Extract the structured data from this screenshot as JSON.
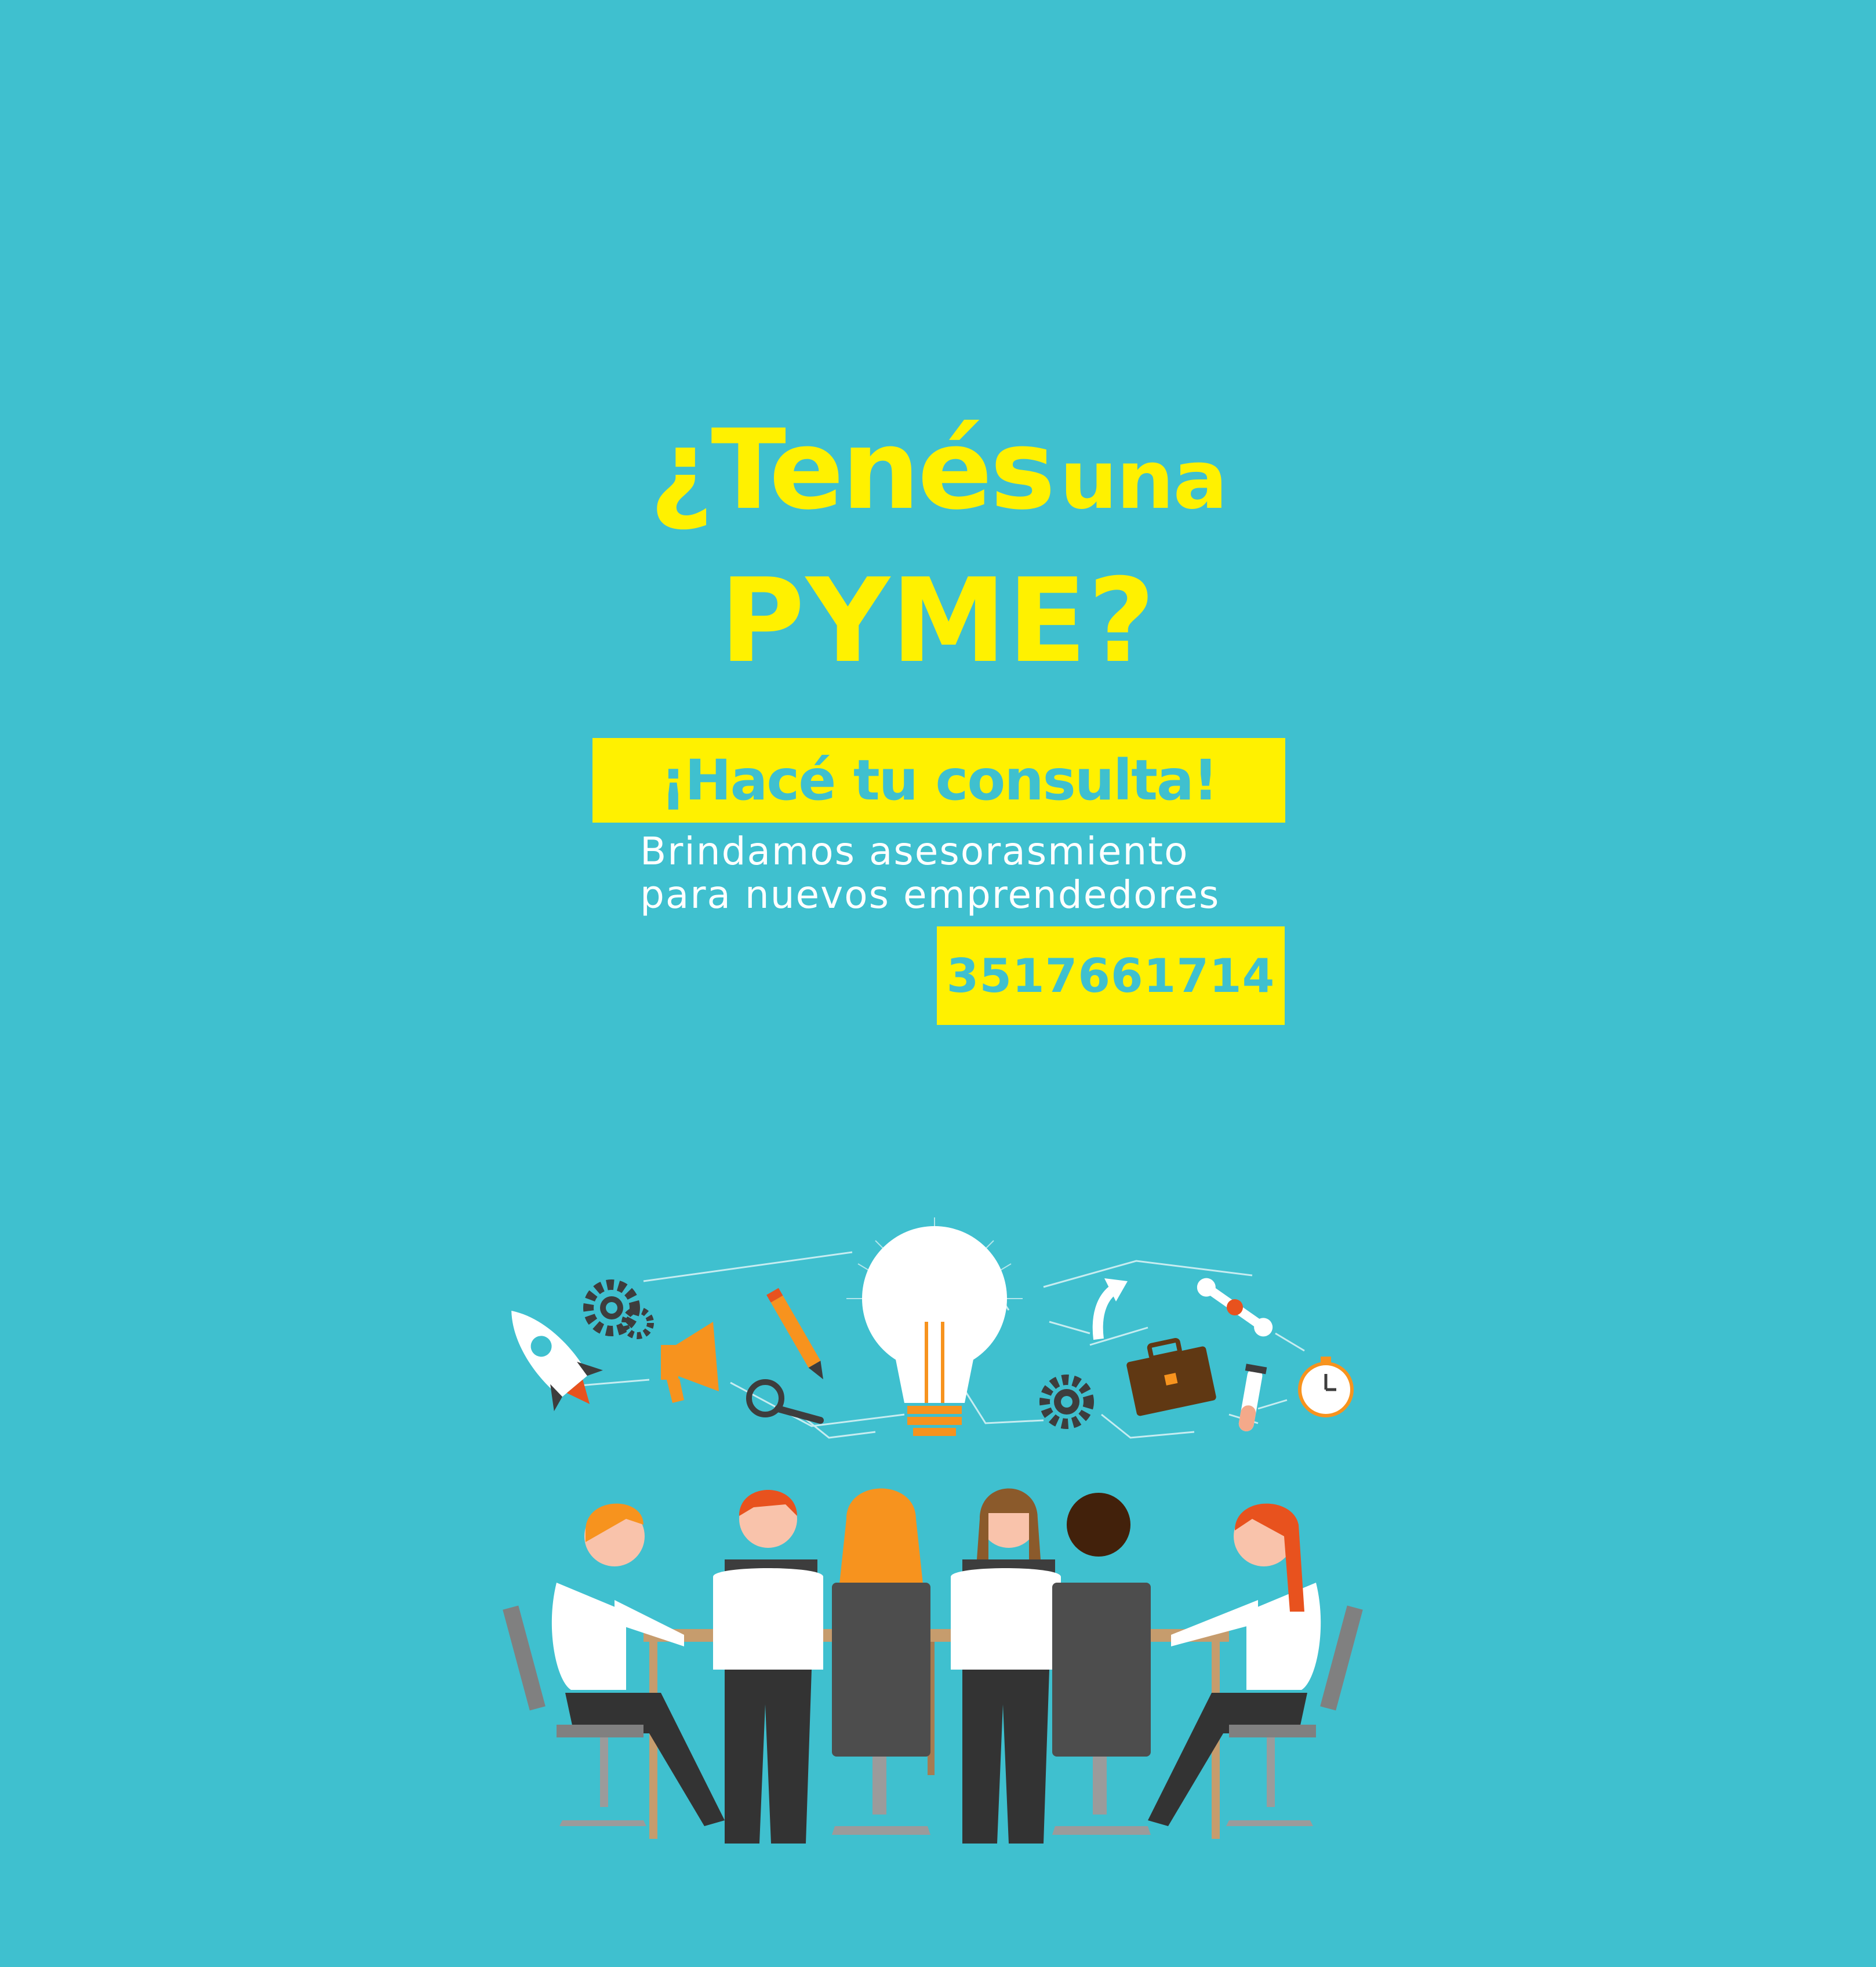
{
  "headline": {
    "line1_part1": "¿Tenés",
    "line1_part2": "una",
    "line2": "PYME?"
  },
  "cta": {
    "label": "¡Hacé tu consulta!"
  },
  "subtitle": {
    "line1": "Brindamos asesorasmiento",
    "line2": "para nuevos emprendedores"
  },
  "contact": {
    "phone": "3517661714"
  },
  "colors": {
    "background": "#3fc0cf",
    "accent_yellow": "#fff100",
    "white": "#ffffff"
  },
  "illustration": {
    "icons": [
      "rocket-icon",
      "gears-icon",
      "megaphone-icon",
      "pencil-icon",
      "magnifier-icon",
      "lightbulb-icon",
      "gear-icon",
      "arrow-icon",
      "briefcase-icon",
      "wrench-icon",
      "test-tube-icon",
      "stopwatch-icon"
    ],
    "scene": "team-meeting"
  }
}
